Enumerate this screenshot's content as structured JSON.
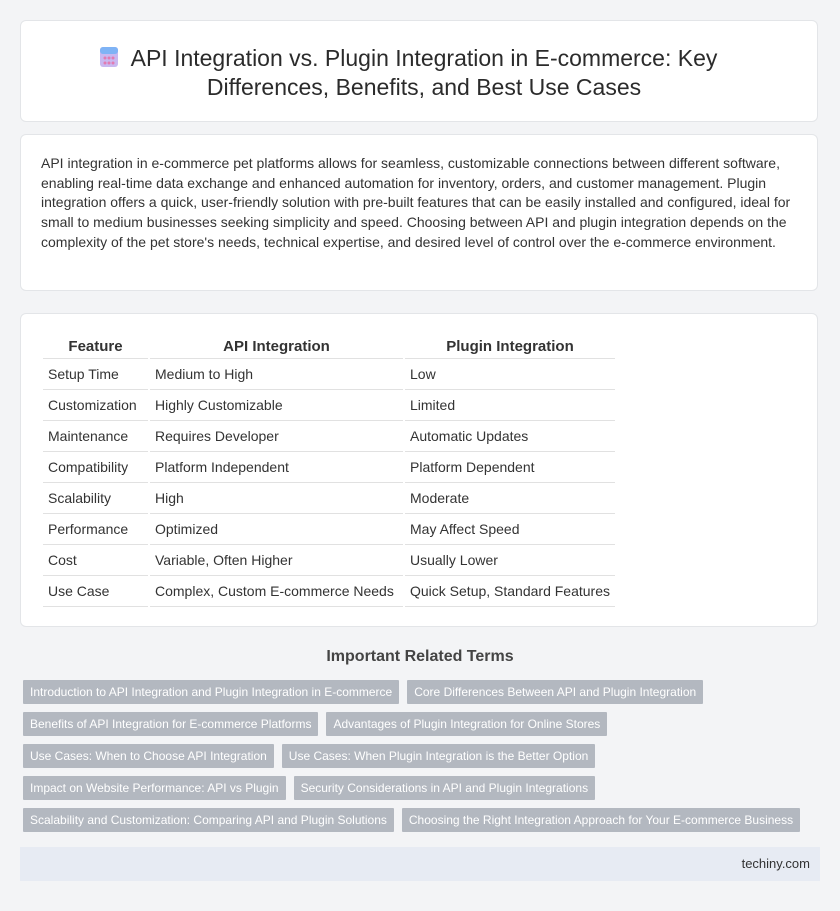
{
  "header": {
    "icon": "calculator-icon",
    "title": "API Integration vs. Plugin Integration in E-commerce: Key Differences, Benefits, and Best Use Cases"
  },
  "intro": {
    "text": "API integration in e-commerce pet platforms allows for seamless, customizable connections between different software, enabling real-time data exchange and enhanced automation for inventory, orders, and customer management. Plugin integration offers a quick, user-friendly solution with pre-built features that can be easily installed and configured, ideal for small to medium businesses seeking simplicity and speed. Choosing between API and plugin integration depends on the complexity of the pet store's needs, technical expertise, and desired level of control over the e-commerce environment."
  },
  "table": {
    "headers": [
      "Feature",
      "API Integration",
      "Plugin Integration"
    ],
    "rows": [
      [
        "Setup Time",
        "Medium to High",
        "Low"
      ],
      [
        "Customization",
        "Highly Customizable",
        "Limited"
      ],
      [
        "Maintenance",
        "Requires Developer",
        "Automatic Updates"
      ],
      [
        "Compatibility",
        "Platform Independent",
        "Platform Dependent"
      ],
      [
        "Scalability",
        "High",
        "Moderate"
      ],
      [
        "Performance",
        "Optimized",
        "May Affect Speed"
      ],
      [
        "Cost",
        "Variable, Often Higher",
        "Usually Lower"
      ],
      [
        "Use Case",
        "Complex, Custom E-commerce Needs",
        "Quick Setup, Standard Features"
      ]
    ]
  },
  "related": {
    "title": "Important Related Terms",
    "rows": [
      [
        "Introduction to API Integration and Plugin Integration in E-commerce",
        "Core Differences Between API and Plugin Integration"
      ],
      [
        "Benefits of API Integration for E-commerce Platforms",
        "Advantages of Plugin Integration for Online Stores"
      ],
      [
        "Use Cases: When to Choose API Integration",
        "Use Cases: When Plugin Integration is the Better Option"
      ],
      [
        "Impact on Website Performance: API vs Plugin",
        "Security Considerations in API and Plugin Integrations"
      ],
      [
        "Scalability and Customization: Comparing API and Plugin Solutions",
        "Choosing the Right Integration Approach for Your E-commerce Business"
      ]
    ]
  },
  "footer": {
    "brand": "techiny.com"
  }
}
